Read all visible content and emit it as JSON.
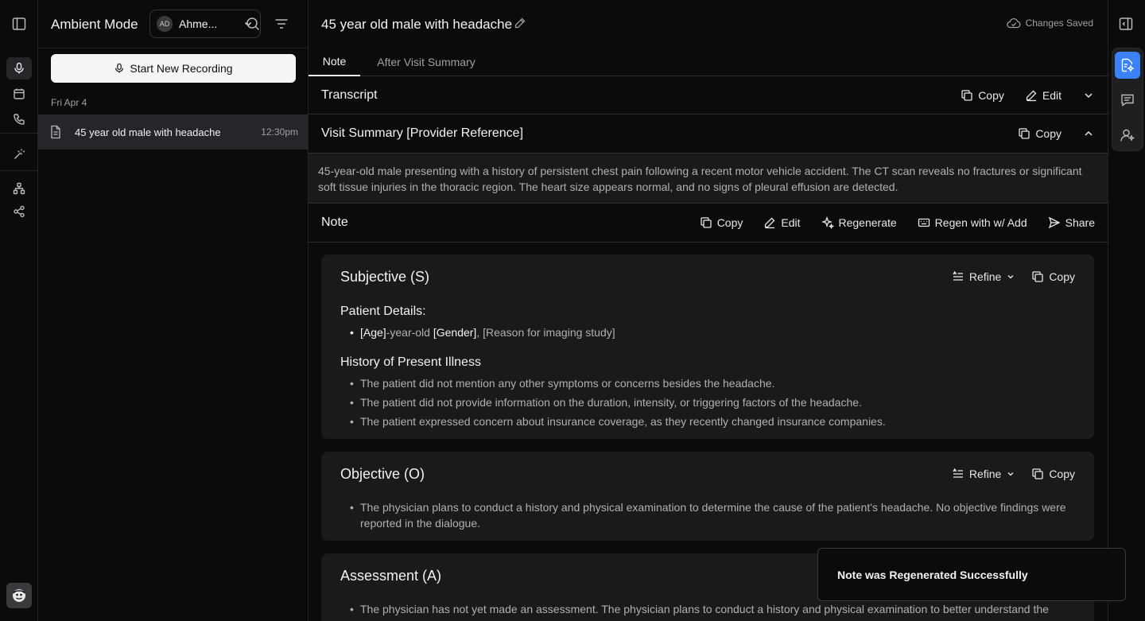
{
  "sidebar": {
    "title": "Ambient Mode",
    "user": {
      "initials": "AD",
      "name": "Ahme..."
    },
    "record_label": "Start New Recording",
    "date_label": "Fri Apr 4",
    "sessions": [
      {
        "title": "45 year old male with headache",
        "time": "12:30pm"
      }
    ]
  },
  "header": {
    "title": "45 year old male with headache",
    "saved_status": "Changes Saved"
  },
  "tabs": [
    {
      "label": "Note",
      "active": true
    },
    {
      "label": "After Visit Summary",
      "active": false
    }
  ],
  "transcript": {
    "title": "Transcript",
    "copy_label": "Copy",
    "edit_label": "Edit"
  },
  "visit_summary": {
    "title": "Visit Summary [Provider Reference]",
    "copy_label": "Copy",
    "text": "45-year-old male presenting with a history of persistent chest pain following a recent motor vehicle accident. The CT scan reveals no fractures or significant soft tissue injuries in the thoracic region. The heart size appears normal, and no signs of pleural effusion are detected."
  },
  "note": {
    "title": "Note",
    "actions": {
      "copy": "Copy",
      "edit": "Edit",
      "regenerate": "Regenerate",
      "regen_add": "Regen with w/ Add",
      "share": "Share"
    }
  },
  "sections": {
    "refine_label": "Refine",
    "copy_label": "Copy",
    "subjective": {
      "title": "Subjective (S)",
      "patient_details_heading": "Patient Details:",
      "patient_details": {
        "age": "[Age]",
        "mid": "-year-old ",
        "gender": "[Gender]",
        "rest": ", [Reason for imaging study]"
      },
      "hpi_heading": "History of Present Illness",
      "hpi": [
        "The patient did not mention any other symptoms or concerns besides the headache.",
        "The patient did not provide information on the duration, intensity, or triggering factors of the headache.",
        "The patient expressed concern about insurance coverage, as they recently changed insurance companies."
      ]
    },
    "objective": {
      "title": "Objective (O)",
      "bullets": [
        "The physician plans to conduct a history and physical examination to determine the cause of the patient's headache. No objective findings were reported in the dialogue."
      ]
    },
    "assessment": {
      "title": "Assessment (A)",
      "bullets": [
        "The physician has not yet made an assessment. The physician plans to conduct a history and physical examination to better understand the"
      ]
    }
  },
  "toast": {
    "message": "Note was Regenerated Successfully"
  },
  "colors": {
    "accent": "#3b82f6",
    "background": "#0b0b0c",
    "card": "#1a1a1c"
  }
}
